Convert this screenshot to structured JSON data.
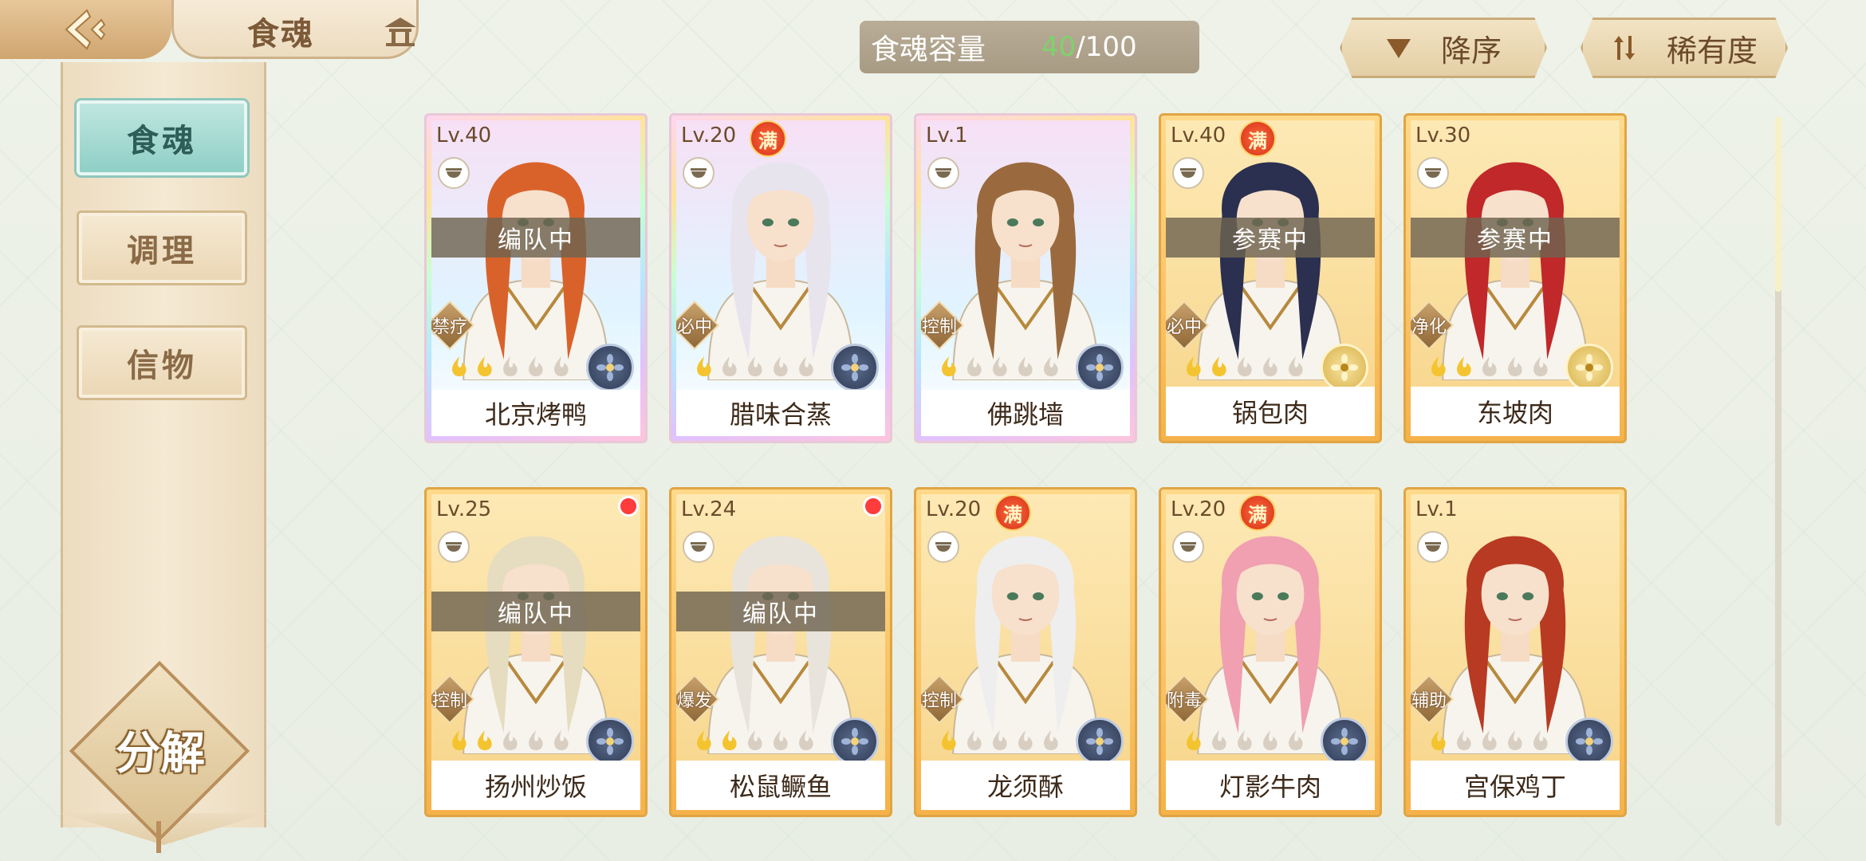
{
  "header": {
    "title": "食魂"
  },
  "capacity": {
    "label": "食魂容量",
    "current": "40",
    "separator": "/",
    "max": "100",
    "current_color": "#7ed36a"
  },
  "sort": {
    "order_label": "降序",
    "rarity_label": "稀有度"
  },
  "sidebar": {
    "items": [
      {
        "label": "食魂",
        "active": true
      },
      {
        "label": "调理",
        "active": false
      },
      {
        "label": "信物",
        "active": false
      }
    ],
    "decompose_label": "分解"
  },
  "cards": [
    {
      "level": "Lv.40",
      "full": "",
      "status": "编队中",
      "role": "禁疗",
      "stars": 2,
      "name": "北京烤鸭",
      "frame": "rainbow",
      "emblem": "blue",
      "hair": "#d9622b",
      "red_dot": false
    },
    {
      "level": "Lv.20",
      "full": "满",
      "status": "",
      "role": "必中",
      "stars": 1,
      "name": "腊味合蒸",
      "frame": "rainbow",
      "emblem": "blue",
      "hair": "#e8e4ee",
      "red_dot": false
    },
    {
      "level": "Lv.1",
      "full": "",
      "status": "",
      "role": "控制",
      "stars": 1,
      "name": "佛跳墙",
      "frame": "rainbow",
      "emblem": "blue",
      "hair": "#9a6a3e",
      "red_dot": false
    },
    {
      "level": "Lv.40",
      "full": "满",
      "status": "参赛中",
      "role": "必中",
      "stars": 2,
      "name": "锅包肉",
      "frame": "gold",
      "emblem": "gold",
      "hair": "#2b3050",
      "red_dot": false
    },
    {
      "level": "Lv.30",
      "full": "",
      "status": "参赛中",
      "role": "净化",
      "stars": 2,
      "name": "东坡肉",
      "frame": "gold",
      "emblem": "gold",
      "hair": "#c0282a",
      "red_dot": false
    },
    {
      "level": "Lv.25",
      "full": "",
      "status": "编队中",
      "role": "控制",
      "stars": 2,
      "name": "扬州炒饭",
      "frame": "gold",
      "emblem": "blue",
      "hair": "#e6dcc0",
      "red_dot": true
    },
    {
      "level": "Lv.24",
      "full": "",
      "status": "编队中",
      "role": "爆发",
      "stars": 2,
      "name": "松鼠鳜鱼",
      "frame": "gold",
      "emblem": "blue",
      "hair": "#e8e4dc",
      "red_dot": true
    },
    {
      "level": "Lv.20",
      "full": "满",
      "status": "",
      "role": "控制",
      "stars": 1,
      "name": "龙须酥",
      "frame": "gold",
      "emblem": "blue",
      "hair": "#eeeeee",
      "red_dot": false
    },
    {
      "level": "Lv.20",
      "full": "满",
      "status": "",
      "role": "附毒",
      "stars": 1,
      "name": "灯影牛肉",
      "frame": "gold",
      "emblem": "blue",
      "hair": "#f0a0b0",
      "red_dot": false
    },
    {
      "level": "Lv.1",
      "full": "",
      "status": "",
      "role": "辅助",
      "stars": 1,
      "name": "宫保鸡丁",
      "frame": "gold",
      "emblem": "blue",
      "hair": "#b83a22",
      "red_dot": false
    }
  ],
  "colors": {
    "gold_frame": "#f6b24a",
    "active_tab": "#8fcfc6",
    "status_bar": "#6e6450"
  }
}
